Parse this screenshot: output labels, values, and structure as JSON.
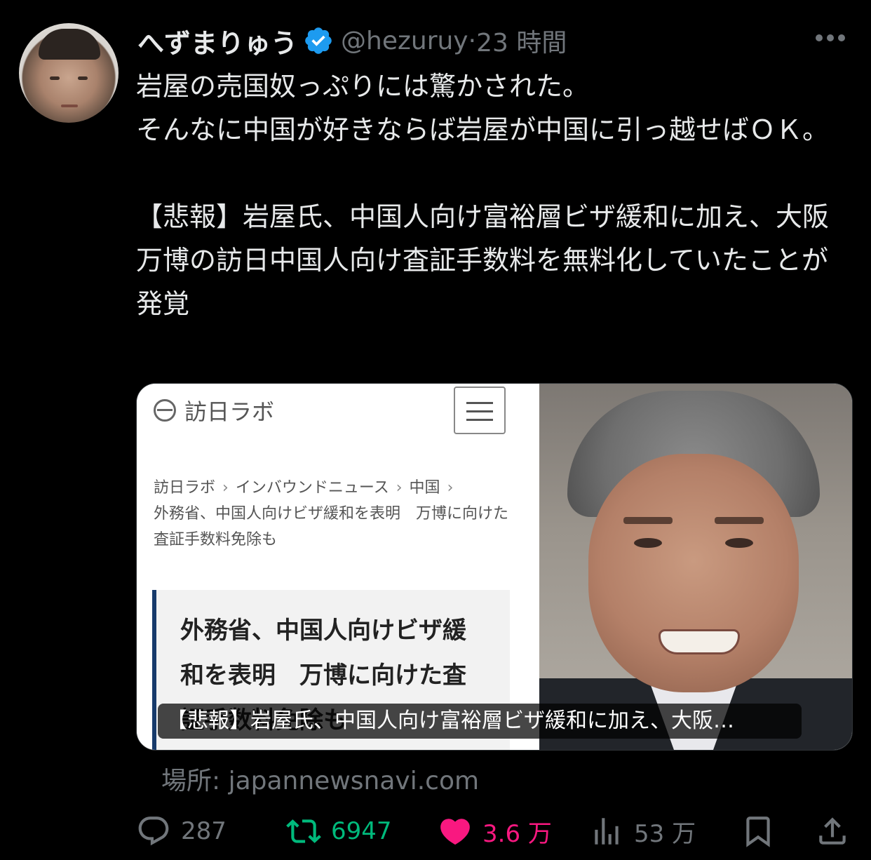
{
  "author": {
    "name": "へずまりゅう",
    "handle": "@hezuruy",
    "separator": "·",
    "time": "23 時間"
  },
  "tweet": {
    "text": "岩屋の売国奴っぷりには驚かされた。\nそんなに中国が好きならば岩屋が中国に引っ越せばＯＫ。\n\n【悲報】岩屋氏、中国人向け富裕層ビザ緩和に加え、大阪万博の訪日中国人向け査証手数料を無料化していたことが発覚"
  },
  "card": {
    "site_name": "訪日ラボ",
    "breadcrumbs": [
      "訪日ラボ",
      "インバウンドニュース",
      "中国"
    ],
    "breadcrumb_title": "外務省、中国人向けビザ緩和を表明　万博に向けた査証手数料免除も",
    "headline": "外務省、中国人向けビザ緩和を表明　万博に向けた査証手数料免除も",
    "caption": "【悲報】岩屋氏、中国人向け富裕層ビザ緩和に加え、大阪…"
  },
  "source": "場所: japannewsnavi.com",
  "actions": {
    "replies": "287",
    "retweets": "6947",
    "likes": "3.6 万",
    "views": "53 万"
  },
  "colors": {
    "background": "#000000",
    "text": "#e7e9ea",
    "muted": "#71767b",
    "verified": "#1d9bf0",
    "retweet": "#00ba7c",
    "like": "#f91880"
  },
  "icons": [
    "verified-icon",
    "more-icon",
    "reply-icon",
    "retweet-icon",
    "like-icon",
    "views-icon",
    "bookmark-icon",
    "share-icon",
    "hamburger-menu-icon",
    "site-logo-icon"
  ]
}
